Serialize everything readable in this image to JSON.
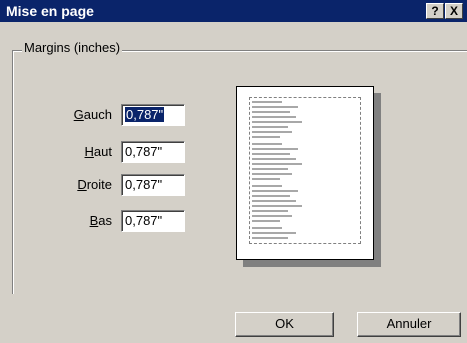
{
  "window": {
    "title": "Mise en page",
    "help_glyph": "?",
    "close_glyph": "X"
  },
  "margins": {
    "group_label": "Margins (inches)",
    "fields": [
      {
        "label_accel": "G",
        "label_rest": "auch",
        "value": "0,787\"",
        "selected": true
      },
      {
        "label_accel": "H",
        "label_rest": "aut",
        "value": "0,787\"",
        "selected": false
      },
      {
        "label_accel": "D",
        "label_rest": "roite",
        "value": "0,787\"",
        "selected": false
      },
      {
        "label_accel": "B",
        "label_rest": "as",
        "value": "0,787\"",
        "selected": false
      }
    ]
  },
  "buttons": {
    "ok": "OK",
    "cancel": "Annuler"
  },
  "colors": {
    "face": "#d4d0c8",
    "titlebar": "#0a246a",
    "selection": "#0a246a"
  }
}
